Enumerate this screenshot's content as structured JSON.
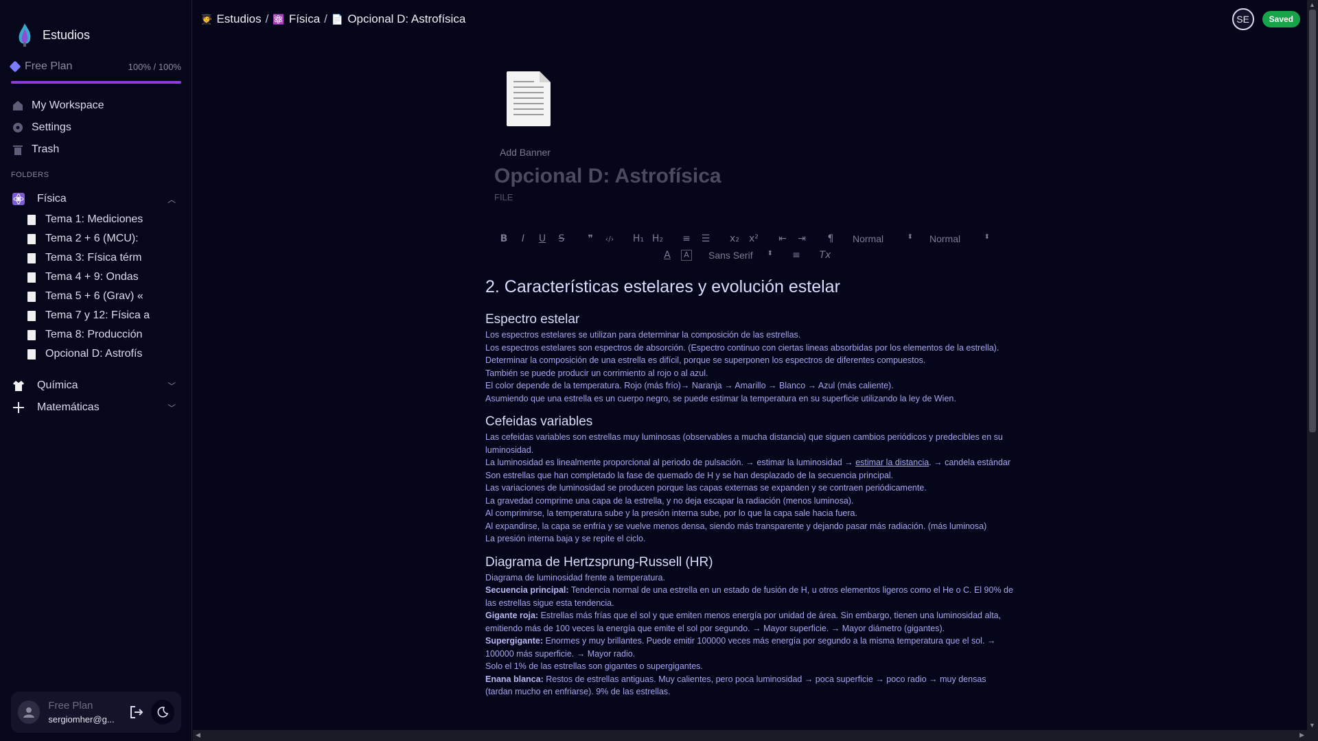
{
  "app": {
    "name": "Estudios"
  },
  "plan": {
    "label": "Free Plan",
    "usage": "100% / 100%",
    "fill_fraction": 1.0
  },
  "nav": [
    {
      "label": "My Workspace",
      "icon": "home-icon"
    },
    {
      "label": "Settings",
      "icon": "gear-icon"
    },
    {
      "label": "Trash",
      "icon": "trash-icon"
    }
  ],
  "folders_label": "FOLDERS",
  "folders": [
    {
      "label": "Física",
      "emoji": "⚛️",
      "expanded": true
    },
    {
      "label": "Química",
      "emoji": "🥼",
      "expanded": false
    },
    {
      "label": "Matemáticas",
      "emoji": "➕",
      "expanded": false
    }
  ],
  "files": [
    "Tema 1: Mediciones",
    "Tema 2 + 6 (MCU):",
    "Tema 3: Física térm",
    "Tema 4 + 9: Ondas",
    "Tema 5 + 6 (Grav) «",
    "Tema 7 y 12: Física a",
    "Tema 8: Producción",
    "Opcional D: Astrofís"
  ],
  "user": {
    "plan": "Free Plan",
    "email": "sergiomher@g..."
  },
  "breadcrumb": {
    "root_emoji": "🧑‍🎓",
    "root": "Estudios",
    "folder_emoji": "⚛️",
    "folder": "Física",
    "page_emoji": "📄",
    "page": "Opcional D: Astrofísica",
    "sep": "/"
  },
  "topbar": {
    "avatar_initials": "SE",
    "status": "Saved",
    "status_color": "#16a34a"
  },
  "document": {
    "add_banner": "Add Banner",
    "title": "Opcional D: Astrofísica",
    "type_label": "FILE"
  },
  "toolbar": {
    "bold": "B",
    "italic": "I",
    "underline": "U",
    "strike": "S",
    "quote": "❞",
    "code": "‹/›",
    "h1": "H₁",
    "h2": "H₂",
    "ol": "≡",
    "ul": "☰",
    "sub": "x₂",
    "sup": "x²",
    "outdent": "⇤",
    "indent": "⇥",
    "rtl": "¶",
    "select1": "Normal",
    "select2": "Normal",
    "font_color": "A",
    "bg_color": "A",
    "font": "Sans Serif",
    "align": "≡",
    "clean": "Tx"
  },
  "content": {
    "h1": "2. Características estelares y evolución estelar",
    "s1_title": "Espectro estelar",
    "s1_lines": [
      "Los espectros estelares se utilizan para determinar la composición de las estrellas.",
      "Los espectros estelares son espectros de absorción. (Espectro continuo con ciertas lineas absorbidas por los elementos de la estrella). Determinar la composición de una estrella es difícil, porque se superponen los espectros de diferentes compuestos.",
      "También se puede producir un corrimiento al rojo o al azul.",
      "El color depende de la temperatura. Rojo (más frío)→ Naranja → Amarillo → Blanco → Azul (más caliente).",
      "Asumiendo que una estrella es un cuerpo negro, se puede estimar la temperatura en su superficie utilizando la ley de Wien."
    ],
    "s2_title": "Cefeidas variables",
    "s2_line1": "Las cefeidas variables son estrellas muy luminosas (observables a mucha distancia) que siguen cambios periódicos y predecibles en su luminosidad.",
    "s2_line2a": "La luminosidad es linealmente proporcional al periodo de pulsación. → estimar la luminosidad → ",
    "s2_line2_link": "estimar la distancia",
    "s2_line2b": ". → candela estándar",
    "s2_lines": [
      "Son estrellas que han completado la fase de quemado de H y se han desplazado de la secuencia principal.",
      "Las variaciones de luminosidad se producen porque las capas externas se expanden y se contraen periódicamente.",
      "La gravedad comprime una capa de la estrella, y no deja escapar la radiación (menos luminosa).",
      "Al comprimirse, la temperatura sube y la presión interna sube, por lo que la capa sale hacia fuera.",
      "Al expandirse, la capa se enfría y se vuelve menos densa, siendo más transparente y dejando pasar más radiación. (más luminosa)",
      "La presión interna baja y se repite el ciclo."
    ],
    "s3_title": "Diagrama de Hertzsprung-Russell (HR)",
    "s3_intro": "Diagrama de luminosidad frente a temperatura.",
    "s3_sp_b": "Secuencia principal:",
    "s3_sp": " Tendencia normal de una estrella en un estado de fusión de H, u otros elementos ligeros como el He o C. El 90% de las estrellas sigue esta tendencia.",
    "s3_gr_b": "Gigante roja:",
    "s3_gr": " Estrellas más frías que el sol y que emiten menos energía por unidad de área. Sin embargo, tienen una luminosidad alta, emitiendo más de 100 veces la energía que emite el sol por segundo. → Mayor superficie. → Mayor diámetro (gigantes).",
    "s3_sg_b": "Supergigante:",
    "s3_sg": " Enormes y muy brillantes. Puede emitir 100000 veces más energía por segundo a la misma temperatura que el sol. → 100000 más superficie. → Mayor radio.",
    "s3_pct": "Solo el 1% de las estrellas son gigantes o supergigantes.",
    "s3_eb_b": "Enana blanca:",
    "s3_eb": " Restos de estrellas antiguas. Muy calientes, pero poca luminosidad → poca superficie → poco radio → muy densas (tardan mucho en enfriarse). 9% de las estrellas."
  }
}
